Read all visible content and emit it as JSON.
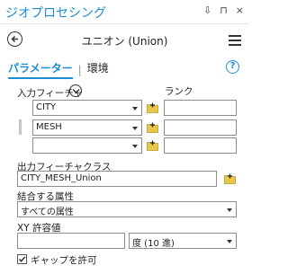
{
  "app": {
    "title": "ジオプロセシング"
  },
  "window_controls": {
    "pin": "⇩",
    "float": "⊓",
    "close": "×"
  },
  "header": {
    "tool_title": "ユニオン (Union)"
  },
  "tabs": [
    {
      "label": "パラメーター",
      "active": true
    },
    {
      "label": "環境",
      "active": false
    }
  ],
  "tab_separator": "|",
  "help": {
    "glyph": "?"
  },
  "input_features": {
    "label": "入力フィーチャ",
    "rank_label": "ランク",
    "rows": [
      {
        "value": "CITY",
        "rank": ""
      },
      {
        "value": "MESH",
        "rank": ""
      },
      {
        "value": "",
        "rank": ""
      }
    ]
  },
  "output": {
    "label": "出力フィーチャクラス",
    "value": "CITY_MESH_Union"
  },
  "join_attributes": {
    "label": "結合する属性",
    "value": "すべての属性"
  },
  "xy_tolerance": {
    "label": "XY 許容値",
    "value": "",
    "unit": "度 (10 進)"
  },
  "gaps": {
    "label": "ギャップを許可",
    "checked": true
  },
  "colors": {
    "accent": "#1a8dd4",
    "folder": "#e8c84a"
  }
}
